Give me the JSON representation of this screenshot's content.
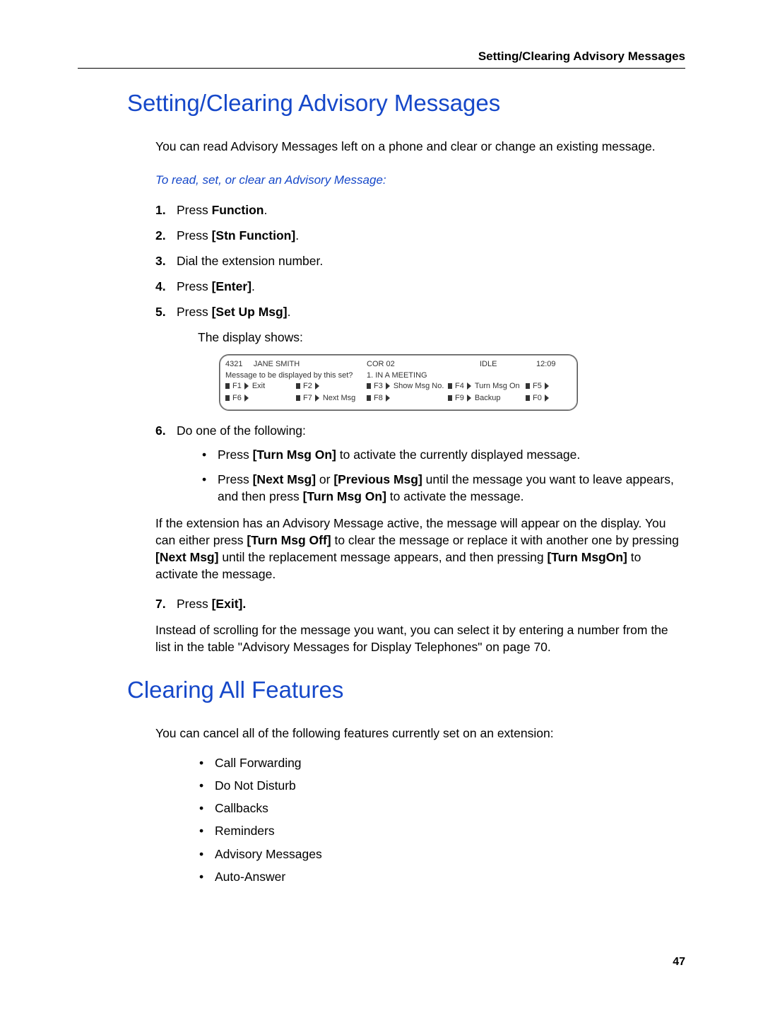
{
  "header": {
    "running_title": "Setting/Clearing Advisory Messages"
  },
  "section1": {
    "title": "Setting/Clearing Advisory Messages",
    "intro": "You can read Advisory Messages left on a phone and clear or change an existing message.",
    "subhead": "To read, set, or clear an Advisory Message:",
    "steps": {
      "s1_num": "1.",
      "s1_pre": "Press ",
      "s1_bold": "Function",
      "s1_post": ".",
      "s2_num": "2.",
      "s2_pre": "Press ",
      "s2_bold": "[Stn Function]",
      "s2_post": ".",
      "s3_num": "3.",
      "s3_text": "Dial the extension number.",
      "s4_num": "4.",
      "s4_pre": "Press ",
      "s4_bold": "[Enter]",
      "s4_post": ".",
      "s5_num": "5.",
      "s5_pre": "Press ",
      "s5_bold": "[Set Up Msg]",
      "s5_post": ".",
      "s5_body": "The display shows:",
      "s6_num": "6.",
      "s6_text": "Do one of the following:",
      "s6_b1_pre": "Press ",
      "s6_b1_bold": "[Turn Msg On]",
      "s6_b1_post": " to activate the currently displayed message.",
      "s6_b2_pre": "Press ",
      "s6_b2_bold1": "[Next Msg]",
      "s6_b2_mid1": " or ",
      "s6_b2_bold2": "[Previous Msg]",
      "s6_b2_mid2": " until the message you want to leave appears, and then press ",
      "s6_b2_bold3": "[Turn Msg On]",
      "s6_b2_post": " to activate the message.",
      "s7_num": "7.",
      "s7_pre": "Press ",
      "s7_bold": "[Exit].",
      "s7_post": ""
    },
    "display": {
      "ext": "4321",
      "name": "JANE SMITH",
      "cor": "COR 02",
      "status": "IDLE",
      "time": "12:09",
      "line2a": "Message to be displayed by this set?",
      "line2b": "1. IN A MEETING",
      "f1": "F1",
      "f1_label": "Exit",
      "f2": "F2",
      "f2_label": "",
      "f3": "F3",
      "f3_label": "Show Msg No.",
      "f4": "F4",
      "f4_label": "Turn Msg On",
      "f5": "F5",
      "f5_label": "",
      "f6": "F6",
      "f6_label": "",
      "f7": "F7",
      "f7_label": "Next Msg",
      "f8": "F8",
      "f8_label": "",
      "f9": "F9",
      "f9_label": "Backup",
      "f0": "F0",
      "f0_label": ""
    },
    "mid_para_a": "If the extension has an Advisory Message active, the message will appear on the display. You can either press ",
    "mid_bold1": "[Turn Msg Off]",
    "mid_para_b": " to clear the message or replace it with another one by pressing ",
    "mid_bold2": "[Next Msg]",
    "mid_para_c": " until the replacement message appears, and then pressing ",
    "mid_bold3": "[Turn MsgOn]",
    "mid_para_d": " to activate the message.",
    "closing": "Instead of scrolling for the message you want, you can select it by entering a number from the list in the table \"Advisory Messages for Display Telephones\" on page 70."
  },
  "section2": {
    "title": "Clearing All Features",
    "intro": "You can cancel all of the following features currently set on an extension:",
    "features": [
      "Call Forwarding",
      "Do Not Disturb",
      "Callbacks",
      "Reminders",
      "Advisory Messages",
      "Auto-Answer"
    ]
  },
  "footer": {
    "page_number": "47"
  }
}
